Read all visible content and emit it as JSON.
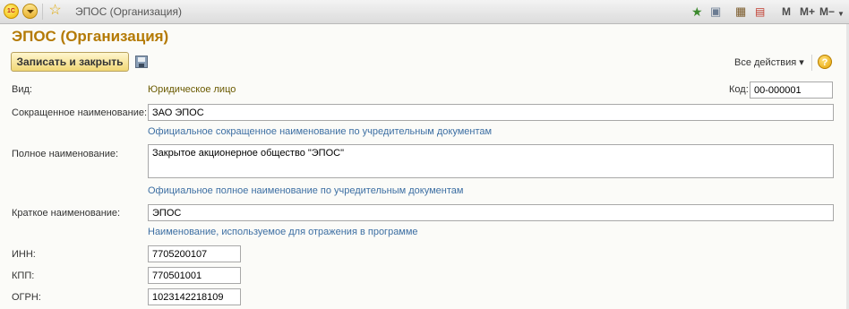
{
  "window": {
    "title": "ЭПОС (Организация)",
    "logo_text": "1С"
  },
  "toolbar_right": {
    "m": "M",
    "m_plus": "M+",
    "m_minus": "M−"
  },
  "form": {
    "title": "ЭПОС (Организация)",
    "save_close_label": "Записать и закрыть",
    "all_actions_label": "Все действия ▾",
    "help_label": "?"
  },
  "fields": {
    "kind": {
      "label": "Вид:",
      "value": "Юридическое лицо"
    },
    "code": {
      "label": "Код:",
      "value": "00-000001"
    },
    "short_name": {
      "label": "Сокращенное наименование:",
      "value": "ЗАО ЭПОС",
      "hint": "Официальное сокращенное наименование по учредительным документам"
    },
    "full_name": {
      "label": "Полное наименование:",
      "value": "Закрытое акционерное общество \"ЭПОС\"",
      "hint": "Официальное полное наименование по учредительным документам"
    },
    "brief_name": {
      "label": "Краткое наименование:",
      "value": "ЭПОС",
      "hint": "Наименование, используемое для отражения в программе"
    },
    "inn": {
      "label": "ИНН:",
      "value": "7705200107"
    },
    "kpp": {
      "label": "КПП:",
      "value": "770501001"
    },
    "ogrn": {
      "label": "ОГРН:",
      "value": "1023142218109"
    }
  }
}
